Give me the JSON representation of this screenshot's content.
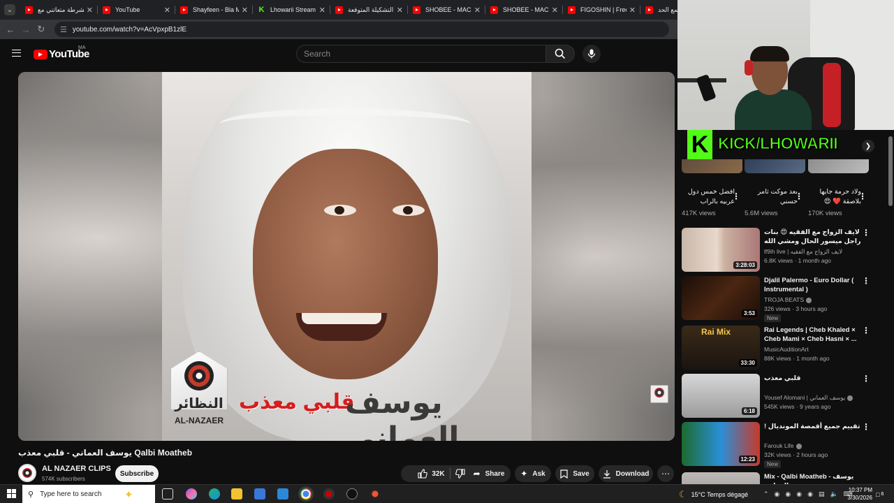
{
  "browser": {
    "tabs": [
      {
        "title": "الشرطة متعاتني مع",
        "icon": "youtube-icon"
      },
      {
        "title": "YouTube",
        "icon": "youtube-icon"
      },
      {
        "title": "Shayfeen - Bla M",
        "icon": "youtube-icon"
      },
      {
        "title": "Lhowarii Stream",
        "icon": "kick-icon"
      },
      {
        "title": "التشكيلة المتوقعة",
        "icon": "youtube-icon"
      },
      {
        "title": "SHOBEE - MACHI",
        "icon": "youtube-icon"
      },
      {
        "title": "SHOBEE - MACHI",
        "icon": "youtube-icon"
      },
      {
        "title": "FIGOSHIN | Frees",
        "icon": "youtube-icon"
      },
      {
        "title": "اسمع الحد",
        "icon": "youtube-icon"
      }
    ],
    "url": "youtube.com/watch?v=AcVpxpB1zlE"
  },
  "youtube": {
    "logo_text": "YouTube",
    "country_code": "MA",
    "search_placeholder": "Search"
  },
  "video": {
    "title": "يوسف العماني - قلبي معذب Qalbi Moatheb",
    "cover_text_artist": "يوسف العماني",
    "cover_text_song": "قلبي معذب",
    "label_arabic": "النظائر",
    "label_latin": "AL-NAZAER",
    "channel": "AL NAZAER CLIPS",
    "subscribers": "574K subscribers",
    "subscribe_label": "Subscribe",
    "likes": "32K",
    "share_label": "Share",
    "ask_label": "Ask",
    "save_label": "Save",
    "download_label": "Download"
  },
  "stream_overlay": {
    "kick_logo": "K",
    "kick_text": "KICK/LHOWARII"
  },
  "shorts": [
    {
      "title": "افضل خمس دول عربيه بالراب",
      "views": "417K views"
    },
    {
      "title": "بعد موكت ثامر حسني",
      "views": "5.6M views"
    },
    {
      "title": "ولاد حرمة جايها بلاصقة ❤️ 😍",
      "views": "170K views"
    }
  ],
  "recommendations": [
    {
      "title": "لايف الزواج مع الفقيه 😍 بنات راجل ميسور الحال ومشي الله ❤️",
      "channel": "lf9ih live | لايف الزواج مع الفقيه",
      "meta": "6.8K views · 1 month ago",
      "duration": "3:28:03",
      "new": "",
      "rtl": true
    },
    {
      "title": "Djalil Palermo - Euro Dollar ( Instrumental )",
      "channel": "TROJA BEATS",
      "meta": "326 views · 3 hours ago",
      "duration": "3:53",
      "new": "New",
      "rtl": false
    },
    {
      "title": "Rai Legends | Cheb Khaled × Cheb Mami × Cheb Hasni × ...",
      "channel": "MusicAuditionArt",
      "meta": "88K views · 1 month ago",
      "duration": "33:30",
      "new": "",
      "rtl": false
    },
    {
      "title": "قلبي معذب",
      "channel": "Yousef Alomani | يوسف العماني",
      "meta": "545K views · 9 years ago",
      "duration": "6:18",
      "new": "",
      "rtl": true
    },
    {
      "title": "تقييم جميع أقمصة المونديال !",
      "channel": "Farouk Life",
      "meta": "32K views · 2 hours ago",
      "duration": "12:23",
      "new": "New",
      "rtl": true
    },
    {
      "title": "Mix - Qalbi Moatheb - يوسف العماني",
      "channel": "",
      "meta": "",
      "duration": "",
      "new": "",
      "rtl": false
    }
  ],
  "rec_thumb_text": {
    "rai_mix": "Rai Mix"
  },
  "taskbar": {
    "search_placeholder": "Type here to search",
    "weather": "15°C  Temps dégagé",
    "time": "10:37 PM",
    "date": "3/30/2026",
    "notifications": "6"
  }
}
